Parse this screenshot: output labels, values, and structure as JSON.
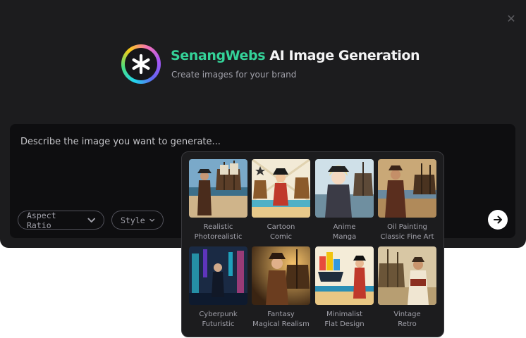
{
  "header": {
    "brand_accent": "SenangWebs",
    "brand_rest": " AI Image Generation",
    "subtitle": "Create images for your brand"
  },
  "prompt": {
    "placeholder": "Describe the image you want to generate..."
  },
  "controls": {
    "aspect_ratio_label": "Aspect Ratio",
    "style_label": "Style"
  },
  "styles": [
    {
      "line1": "Realistic",
      "line2": "Photorealistic"
    },
    {
      "line1": "Cartoon",
      "line2": "Comic"
    },
    {
      "line1": "Anime",
      "line2": "Manga"
    },
    {
      "line1": "Oil Painting",
      "line2": "Classic Fine Art"
    },
    {
      "line1": "Cyberpunk",
      "line2": "Futuristic"
    },
    {
      "line1": "Fantasy",
      "line2": "Magical Realism"
    },
    {
      "line1": "Minimalist",
      "line2": "Flat Design"
    },
    {
      "line1": "Vintage",
      "line2": "Retro"
    }
  ],
  "icons": {
    "close": "close-icon",
    "logo": "asterisk-logo-icon",
    "chevron": "chevron-down-icon",
    "submit": "arrow-right-icon"
  },
  "colors": {
    "accent": "#34d399",
    "panel": "#1c1c1e",
    "input_bg": "#0e0e10",
    "muted_text": "#a1a1aa"
  }
}
